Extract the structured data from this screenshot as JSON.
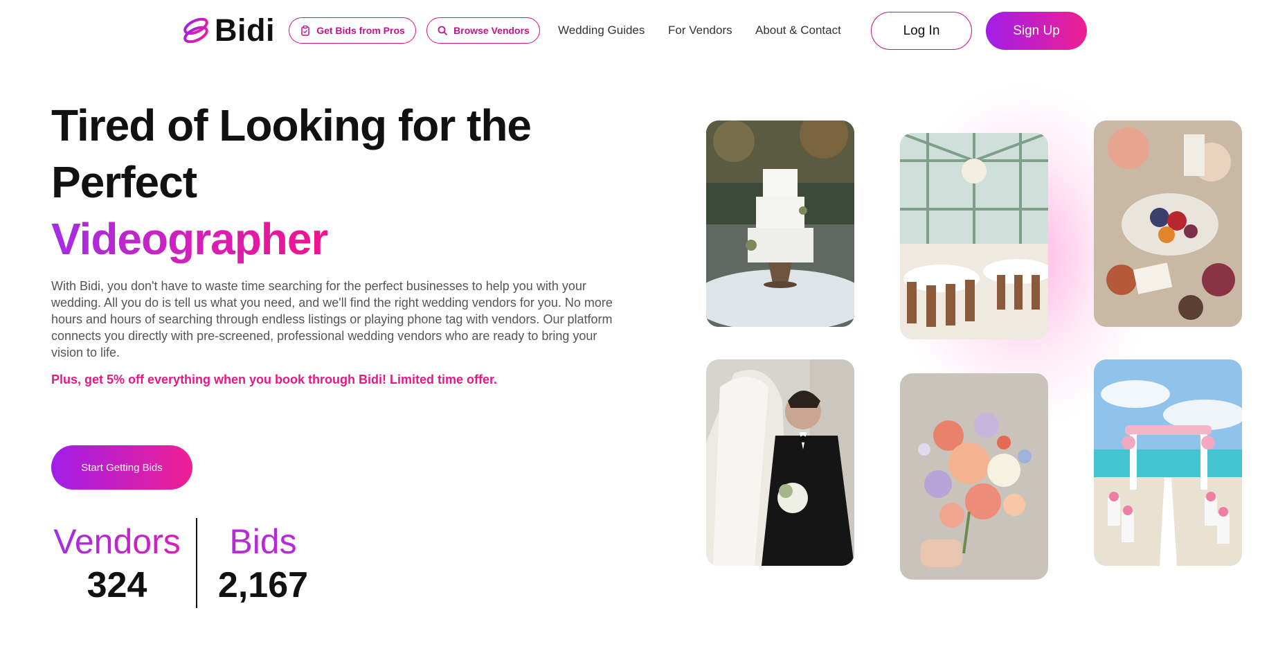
{
  "brand": {
    "name": "Bidi",
    "accent": "#c1138d",
    "gradient_start": "#a11ee8",
    "gradient_end": "#ef1f93"
  },
  "nav": {
    "get_bids_label": "Get Bids from Pros",
    "browse_vendors_label": "Browse Vendors",
    "links": [
      "Wedding Guides",
      "For Vendors",
      "About & Contact"
    ],
    "login_label": "Log In",
    "signup_label": "Sign Up"
  },
  "hero": {
    "headline": "Tired of Looking for the Perfect",
    "highlight": "Videographer",
    "description": "With Bidi, you don't have to waste time searching for the perfect businesses to help you with your wedding. All you do is tell us what you need, and we'll find the right wedding vendors for you. No more hours and hours of searching through endless listings or playing phone tag with vendors. Our platform connects you directly with pre-screened, professional wedding vendors who are ready to bring your vision to life.",
    "promo": "Plus, get 5% off everything when you book through Bidi! Limited time offer.",
    "cta_label": "Start Getting Bids"
  },
  "stats": [
    {
      "label": "Vendors",
      "value": "324"
    },
    {
      "label": "Bids",
      "value": "2,167"
    }
  ],
  "gallery": [
    {
      "icon": "wedding-cake-photo"
    },
    {
      "icon": "reception-hall-photo"
    },
    {
      "icon": "food-table-photo"
    },
    {
      "icon": "couple-photo"
    },
    {
      "icon": "bouquet-photo"
    },
    {
      "icon": "beach-aisle-photo"
    }
  ]
}
